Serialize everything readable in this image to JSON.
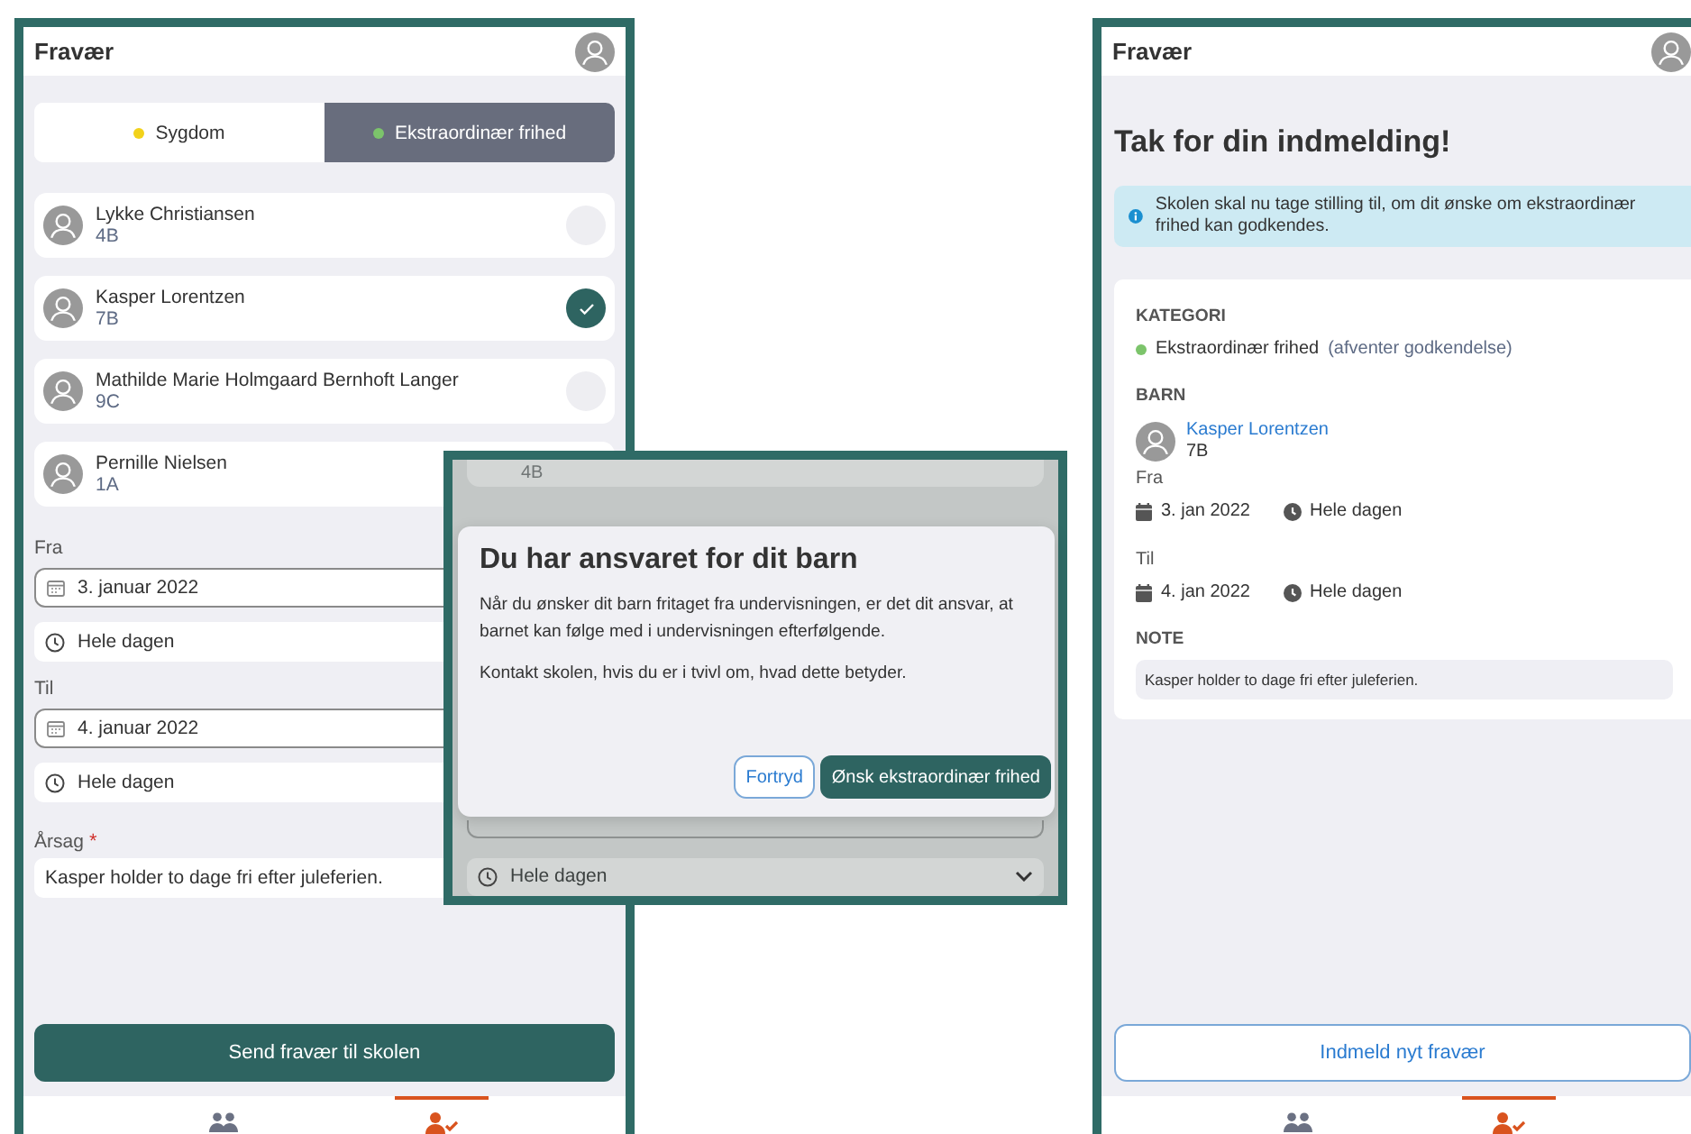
{
  "form_screen": {
    "title": "Fravær",
    "categories": [
      {
        "label": "Sygdom",
        "color": "#f2d21b",
        "selected": false
      },
      {
        "label": "Ekstraordinær frihed",
        "color": "#7cc46b",
        "selected": true
      }
    ],
    "children": [
      {
        "name": "Lykke Christiansen",
        "class": "4B",
        "selected": false
      },
      {
        "name": "Kasper Lorentzen",
        "class": "7B",
        "selected": true
      },
      {
        "name": "Mathilde Marie Holmgaard Bernhoft Langer",
        "class": "9C",
        "selected": false
      },
      {
        "name": "Pernille Nielsen",
        "class": "1A"
      }
    ],
    "from": {
      "label": "Fra",
      "date": "3. januar 2022",
      "time": "Hele dagen"
    },
    "to": {
      "label": "Til",
      "date": "4. januar 2022",
      "time": "Hele dagen"
    },
    "reason": {
      "label": "Årsag",
      "required_mark": "*",
      "value": "Kasper holder to dage fri efter juleferien."
    },
    "submit_button": "Send fravær til skolen",
    "tabs": [
      {
        "kind": "children",
        "selected": false
      },
      {
        "kind": "absence",
        "selected": true
      }
    ]
  },
  "confirm_dialog": {
    "background": {
      "class_text": "4B",
      "time": "Hele dagen"
    },
    "title": "Du har ansvaret for dit barn",
    "paragraphs": [
      "Når du ønsker dit barn fritaget fra undervisningen, er det dit ansvar, at barnet kan følge med i undervisningen efterfølgende.",
      "Kontakt skolen, hvis du er i tvivl om, hvad dette betyder."
    ],
    "buttons": [
      {
        "label": "Fortryd",
        "kind": "secondary"
      },
      {
        "label": "Ønsk ekstraordinær frihed",
        "kind": "primary"
      }
    ]
  },
  "receipt_screen": {
    "title": "Fravær",
    "heading": "Tak for din indmelding!",
    "info": "Skolen skal nu tage stilling til, om dit ønske om ekstraordinær frihed kan godkendes.",
    "category": {
      "label": "KATEGORI",
      "value": "Ekstraordinær frihed",
      "status": "(afventer godkendelse)",
      "color": "#7cc46b"
    },
    "child": {
      "label": "BARN",
      "name": "Kasper Lorentzen",
      "class": "7B"
    },
    "from": {
      "label": "Fra",
      "date": "3. jan 2022",
      "time": "Hele dagen"
    },
    "to": {
      "label": "Til",
      "date": "4. jan 2022",
      "time": "Hele dagen"
    },
    "note": {
      "label": "NOTE",
      "text": "Kasper holder to dage fri efter juleferien."
    },
    "new_button": "Indmeld nyt fravær",
    "tabs": [
      {
        "kind": "children",
        "selected": false
      },
      {
        "kind": "absence",
        "selected": true
      }
    ]
  }
}
